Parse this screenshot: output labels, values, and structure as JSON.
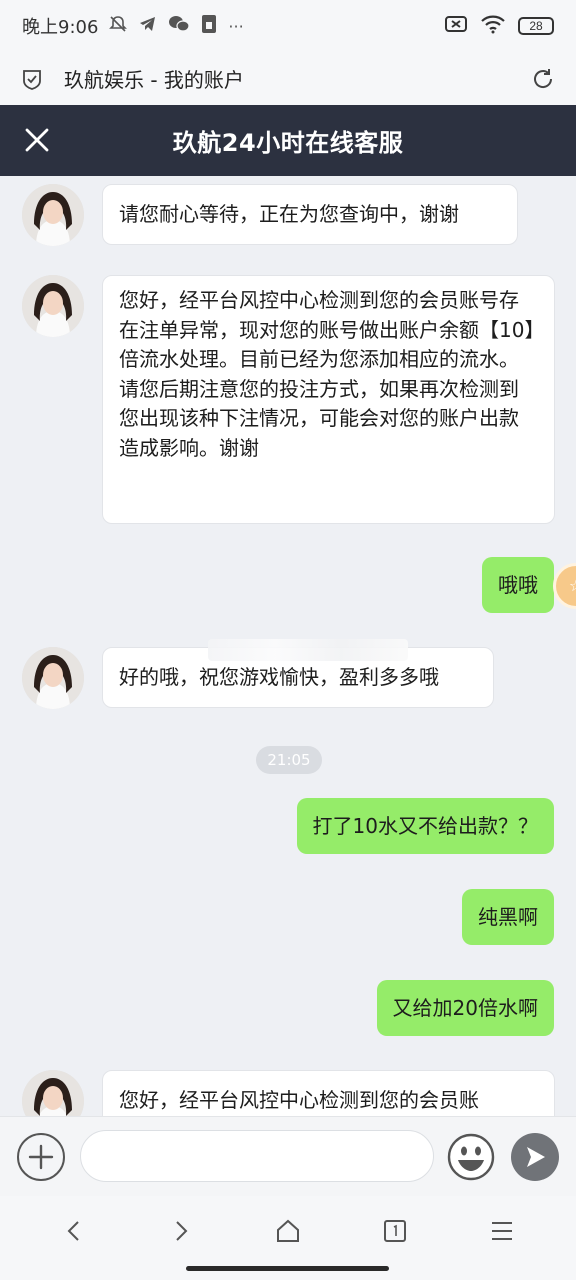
{
  "status_bar": {
    "time": "晚上9:06",
    "icons_left": [
      "mute-icon",
      "telegram-icon",
      "wechat-icon",
      "sim-icon",
      "more-dots-icon"
    ],
    "more": "···",
    "battery": "28"
  },
  "browser": {
    "page_title": "玖航娱乐 - 我的账户"
  },
  "chat": {
    "title": "玖航24小时在线客服",
    "float_badge": "☆",
    "messages": [
      {
        "side": "left",
        "text": "请您耐心等待，正在为您查询中，谢谢"
      },
      {
        "side": "left",
        "text": "您好，经平台风控中心检测到您的会员账号存在注单异常，现对您的账号做出账户余额【10】倍流水处理。目前已经为您添加相应的流水。请您后期注意您的投注方式，如果再次检测到您出现该种下注情况，可能会对您的账户出款造成影响。谢谢"
      },
      {
        "side": "right",
        "text": "哦哦"
      },
      {
        "side": "left",
        "text": "好的哦，祝您游戏愉快，盈利多多哦"
      },
      {
        "side": "time",
        "text": "21:05"
      },
      {
        "side": "right",
        "text": "打了10水又不给出款？？"
      },
      {
        "side": "right",
        "text": "纯黑啊"
      },
      {
        "side": "right",
        "text": "又给加20倍水啊"
      },
      {
        "side": "left",
        "text": "您好，经平台风控中心检测到您的会员账"
      }
    ]
  },
  "input": {
    "placeholder": "",
    "value": ""
  },
  "colors": {
    "header_bg": "#2c3140",
    "bubble_right": "#95ec69",
    "bubble_left": "#ffffff",
    "chat_bg": "#eef0f4"
  }
}
